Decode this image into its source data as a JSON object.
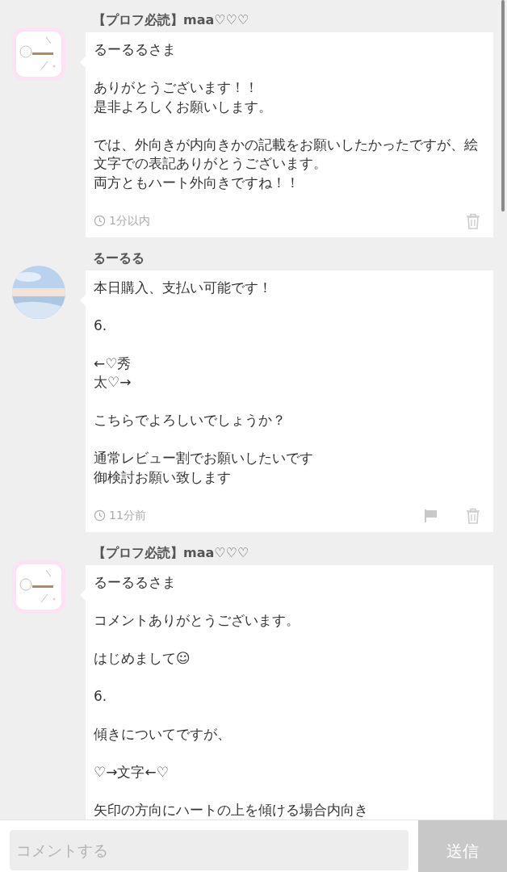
{
  "messages": [
    {
      "author": "【プロフ必読】maa♡♡♡",
      "avatar_round": false,
      "paragraphs": [
        [
          "るーるるさま"
        ],
        [
          "ありがとうございます！！",
          "是非よろしくお願いします。"
        ],
        [
          "では、外向きが内向きかの記載をお願いしたかったですが、絵文字での表記ありがとうございます。",
          "両方ともハート外向きですね！！"
        ]
      ],
      "time": "1分以内",
      "can_report": false
    },
    {
      "author": "るーるる",
      "avatar_round": true,
      "paragraphs": [
        [
          "本日購入、支払い可能です！"
        ],
        [
          "6."
        ],
        [
          "←♡秀",
          "太♡→"
        ],
        [
          "こちらでよろしいでしょうか？"
        ],
        [
          "通常レビュー割でお願いしたいです",
          "御検討お願い致します"
        ]
      ],
      "time": "11分前",
      "can_report": true
    },
    {
      "author": "【プロフ必読】maa♡♡♡",
      "avatar_round": false,
      "paragraphs": [
        [
          "るーるるさま"
        ],
        [
          "コメントありがとうございます。"
        ],
        [
          "はじめまして☺︎"
        ],
        [
          "6."
        ],
        [
          "傾きについてですが、"
        ],
        [
          "♡→文字←♡"
        ],
        [
          "矢印の方向にハートの上を傾ける場合内向き"
        ]
      ]
    }
  ],
  "composer": {
    "placeholder": "コメントする",
    "send": "送信"
  }
}
